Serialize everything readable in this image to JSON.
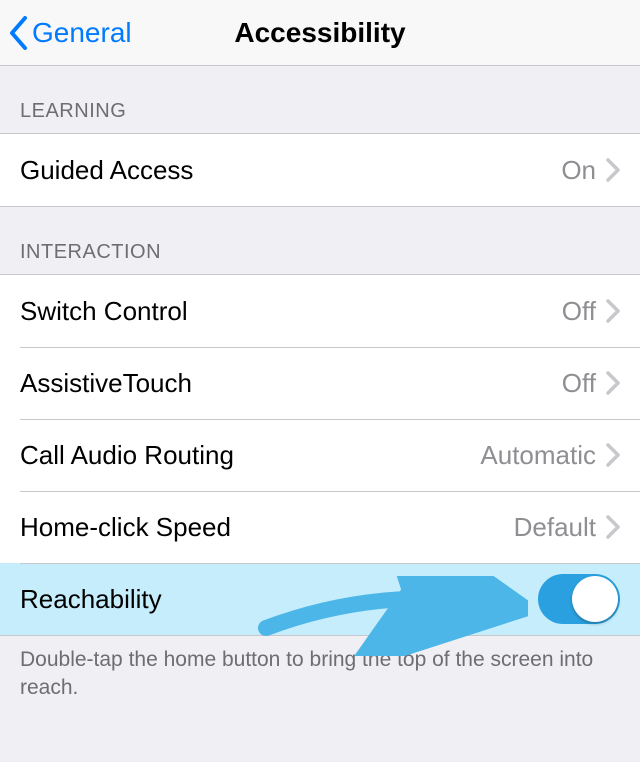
{
  "nav": {
    "back_label": "General",
    "title": "Accessibility"
  },
  "sections": {
    "learning": {
      "header": "LEARNING",
      "guided_access": {
        "label": "Guided Access",
        "value": "On"
      }
    },
    "interaction": {
      "header": "INTERACTION",
      "switch_control": {
        "label": "Switch Control",
        "value": "Off"
      },
      "assistivetouch": {
        "label": "AssistiveTouch",
        "value": "Off"
      },
      "call_audio_routing": {
        "label": "Call Audio Routing",
        "value": "Automatic"
      },
      "home_click_speed": {
        "label": "Home-click Speed",
        "value": "Default"
      },
      "reachability": {
        "label": "Reachability",
        "toggle": true
      }
    }
  },
  "footer": "Double-tap the home button to bring the top of the screen into reach.",
  "colors": {
    "accent": "#007aff",
    "toggle_on": "#2aa0e0",
    "highlight": "#c6edfc",
    "annotation": "#4cb6e8"
  }
}
